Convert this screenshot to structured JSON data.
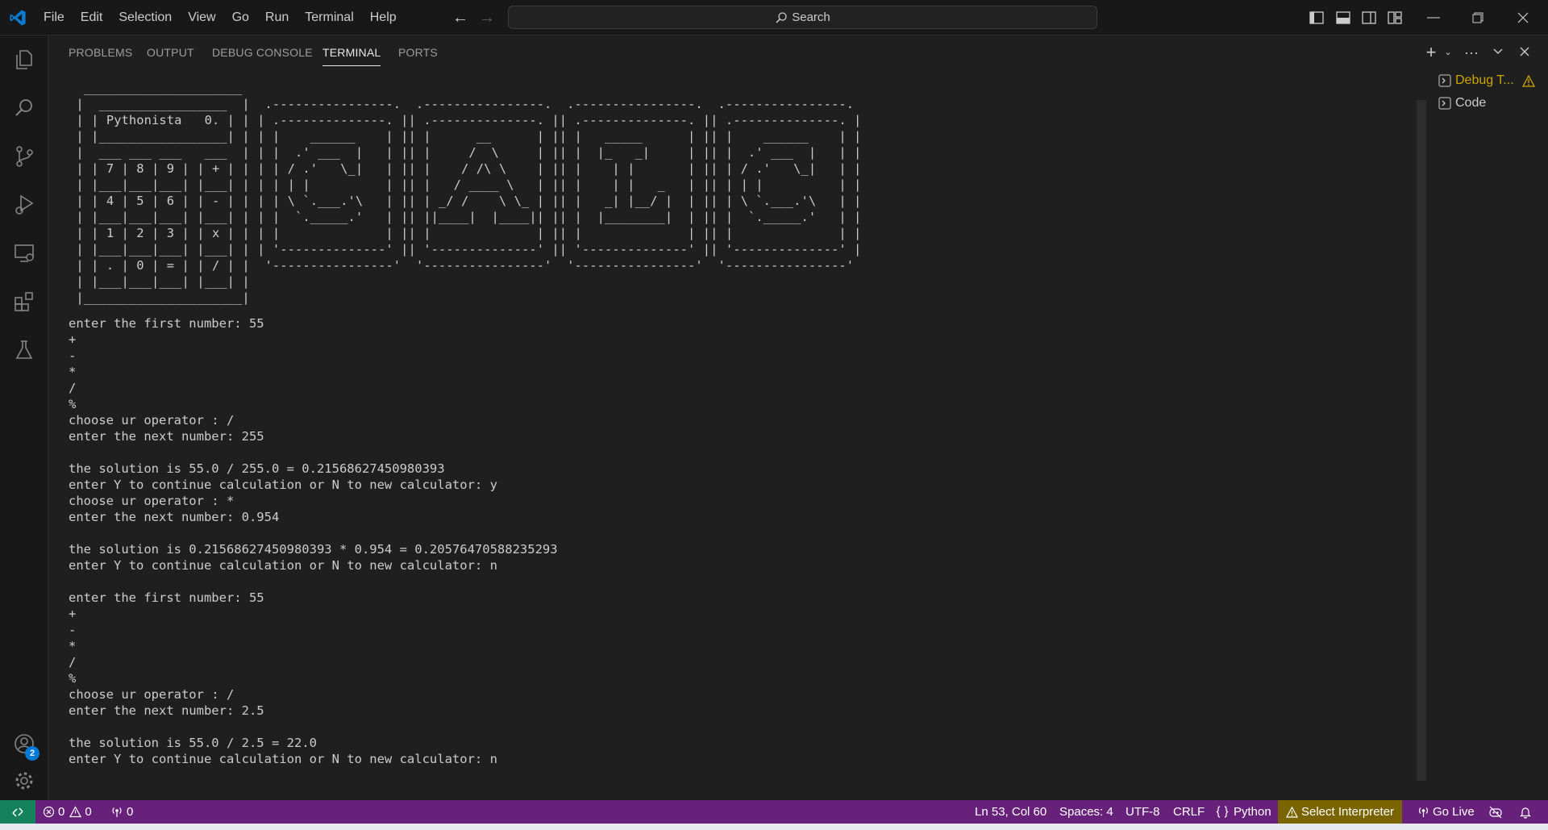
{
  "menu": [
    "File",
    "Edit",
    "Selection",
    "View",
    "Go",
    "Run",
    "Terminal",
    "Help"
  ],
  "search": {
    "label": "Search"
  },
  "activity": {
    "accounts_badge": "2"
  },
  "panel": {
    "tabs": [
      "PROBLEMS",
      "OUTPUT",
      "DEBUG CONSOLE",
      "TERMINAL",
      "PORTS"
    ],
    "active_tab": "TERMINAL"
  },
  "terminals": [
    {
      "label": "Debug T...",
      "warning": true
    },
    {
      "label": "Code",
      "warning": false
    }
  ],
  "terminal": {
    "ascii_art": "  _____________________\n |  _________________  |  .----------------.  .----------------.  .----------------.  .----------------.\n | | Pythonista   0. | | | .--------------. || .--------------. || .--------------. || .--------------. |\n | |_________________| | | |    ______    | || |      __      | || |   _____      | || |    ______    | |\n |  ___ ___ ___   ___  | | |  .' ___  |   | || |     /  \\     | || |  |_   _|     | || |  .' ___  |   | |\n | | 7 | 8 | 9 | | + | | | | / .'   \\_|   | || |    / /\\ \\    | || |    | |       | || | / .'   \\_|   | |\n | |___|___|___| |___| | | | | |          | || |   / ____ \\   | || |    | |   _   | || | | |          | |\n | | 4 | 5 | 6 | | - | | | | \\ `.___.'\\   | || | _/ /    \\ \\_ | || |   _| |__/ |  | || | \\ `.___.'\\   | |\n | |___|___|___| |___| | | |  `._____.'   | || ||____|  |____|| || |  |________|  | || |  `._____.'   | |\n | | 1 | 2 | 3 | | x | | | |              | || |              | || |              | || |              | |\n | |___|___|___| |___| | | '--------------' || '--------------' || '--------------' || '--------------' |\n | | . | 0 | = | | / | |  '----------------'  '----------------'  '----------------'  '----------------'\n | |___|___|___| |___| |\n |_____________________|",
    "lines": [
      "enter the first number: 55",
      "+",
      "-",
      "*",
      "/",
      "%",
      "choose ur operator : /",
      "enter the next number: 255",
      "",
      "the solution is 55.0 / 255.0 = 0.21568627450980393",
      "enter Y to continue calculation or N to new calculator: y",
      "choose ur operator : *",
      "enter the next number: 0.954",
      "",
      "the solution is 0.21568627450980393 * 0.954 = 0.20576470588235293",
      "enter Y to continue calculation or N to new calculator: n",
      "",
      "enter the first number: 55",
      "+",
      "-",
      "*",
      "/",
      "%",
      "choose ur operator : /",
      "enter the next number: 2.5",
      "",
      "the solution is 55.0 / 2.5 = 22.0",
      "enter Y to continue calculation or N to new calculator: n"
    ]
  },
  "status": {
    "errors": "0",
    "warnings": "0",
    "ports": "0",
    "position": "Ln 53, Col 60",
    "spaces": "Spaces: 4",
    "encoding": "UTF-8",
    "eol": "CRLF",
    "language": "Python",
    "interpreter": "Select Interpreter",
    "golive": "Go Live"
  },
  "colors": {
    "statusbar": "#68217a",
    "remote": "#16825d",
    "accent": "#0078d4",
    "warning": "#cca700"
  }
}
